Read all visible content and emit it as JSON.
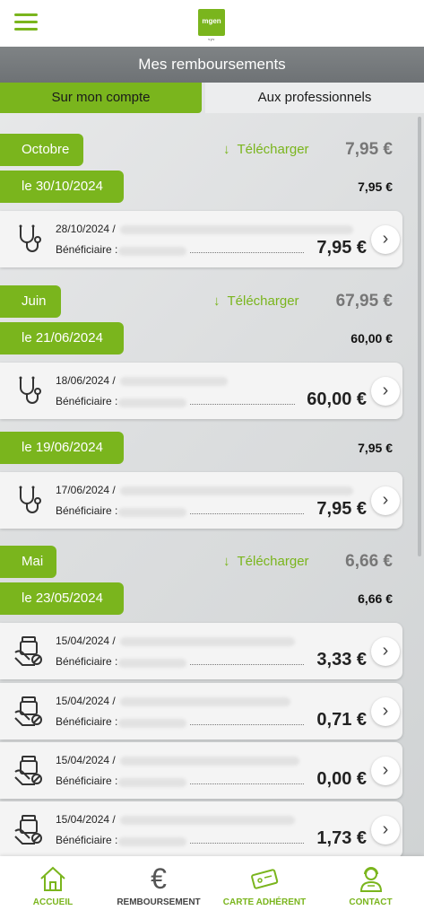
{
  "header": {
    "logo_text": "mgen",
    "logo_sub": "vyv",
    "menu_icon": "hamburger-icon"
  },
  "page_title": "Mes remboursements",
  "tabs": [
    {
      "label": "Sur mon compte",
      "active": true
    },
    {
      "label": "Aux professionnels",
      "active": false
    }
  ],
  "colors": {
    "accent": "#7ab51d",
    "title_bar": "#76797b",
    "muted": "#777777"
  },
  "months": [
    {
      "label": "Octobre",
      "download_label": "Télécharger",
      "total": "7,95 €"
    },
    {
      "label": "Juin",
      "download_label": "Télécharger",
      "total": "67,95 €"
    },
    {
      "label": "Mai",
      "download_label": "Télécharger",
      "total": "6,66 €"
    }
  ],
  "dates": [
    {
      "label": "le 30/10/2024",
      "amount": "7,95 €"
    },
    {
      "label": "le 21/06/2024",
      "amount": "60,00 €"
    },
    {
      "label": "le 19/06/2024",
      "amount": "7,95 €"
    },
    {
      "label": "le 23/05/2024",
      "amount": "6,66 €"
    }
  ],
  "entries": [
    {
      "date": "28/10/2024 /",
      "beneficiary_label": "Bénéficiaire :",
      "amount": "7,95 €",
      "icon": "stethoscope-icon"
    },
    {
      "date": "18/06/2024 /",
      "beneficiary_label": "Bénéficiaire :",
      "amount": "60,00 €",
      "icon": "stethoscope-icon"
    },
    {
      "date": "17/06/2024 /",
      "beneficiary_label": "Bénéficiaire :",
      "amount": "7,95 €",
      "icon": "stethoscope-icon"
    },
    {
      "date": "15/04/2024 /",
      "beneficiary_label": "Bénéficiaire :",
      "amount": "3,33 €",
      "icon": "pharmacy-icon"
    },
    {
      "date": "15/04/2024 /",
      "beneficiary_label": "Bénéficiaire :",
      "amount": "0,71 €",
      "icon": "pharmacy-icon"
    },
    {
      "date": "15/04/2024 /",
      "beneficiary_label": "Bénéficiaire :",
      "amount": "0,00 €",
      "icon": "pharmacy-icon"
    },
    {
      "date": "15/04/2024 /",
      "beneficiary_label": "Bénéficiaire :",
      "amount": "1,73 €",
      "icon": "pharmacy-icon"
    }
  ],
  "nav": [
    {
      "label": "ACCUEIL",
      "icon": "home-icon"
    },
    {
      "label": "REMBOURSEMENT",
      "icon": "euro-icon"
    },
    {
      "label": "CARTE ADHÉRENT",
      "icon": "card-icon"
    },
    {
      "label": "CONTACT",
      "icon": "advisor-icon"
    }
  ]
}
